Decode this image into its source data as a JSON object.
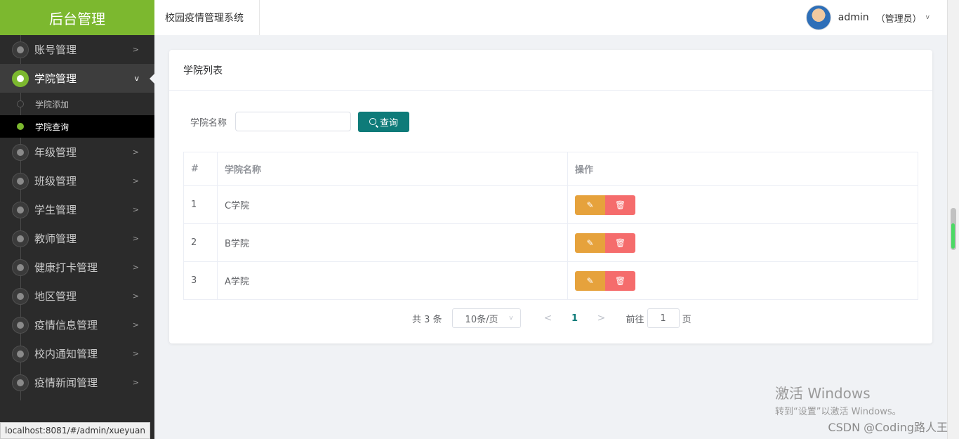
{
  "sidebar": {
    "logo": "后台管理",
    "items": [
      {
        "label": "账号管理"
      },
      {
        "label": "学院管理",
        "sub": [
          {
            "label": "学院添加"
          },
          {
            "label": "学院查询"
          }
        ]
      },
      {
        "label": "年级管理"
      },
      {
        "label": "班级管理"
      },
      {
        "label": "学生管理"
      },
      {
        "label": "教师管理"
      },
      {
        "label": "健康打卡管理"
      },
      {
        "label": "地区管理"
      },
      {
        "label": "疫情信息管理"
      },
      {
        "label": "校内通知管理"
      },
      {
        "label": "疫情新闻管理"
      }
    ]
  },
  "header": {
    "system_title": "校园疫情管理系统",
    "user": {
      "name": "admin",
      "role": "（管理员）"
    }
  },
  "card": {
    "title": "学院列表",
    "search": {
      "label": "学院名称",
      "value": "",
      "button": "查询"
    },
    "table": {
      "headers": [
        "#",
        "学院名称",
        "操作"
      ],
      "rows": [
        {
          "idx": "1",
          "name": "C学院"
        },
        {
          "idx": "2",
          "name": "B学院"
        },
        {
          "idx": "3",
          "name": "A学院"
        }
      ]
    },
    "pagination": {
      "total": "共 3 条",
      "page_size": "10条/页",
      "current_page": "1",
      "goto_label": "前往",
      "goto_value": "1",
      "page_suffix": "页"
    }
  },
  "overlay": {
    "status_url": "localhost:8081/#/admin/xueyuan",
    "activate_title": "激活 Windows",
    "activate_sub": "转到“设置”以激活 Windows。",
    "watermark": "CSDN @Coding路人王"
  },
  "colors": {
    "brand_green": "#7cb82f",
    "primary_teal": "#0e7b79",
    "edit_orange": "#e6a23c",
    "delete_red": "#f56c6c",
    "sidebar_bg": "#2b2b2b"
  }
}
